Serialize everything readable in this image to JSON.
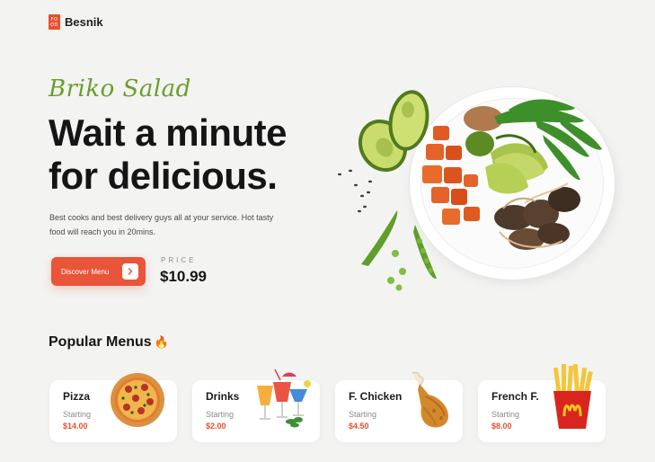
{
  "brand": {
    "logo_line1": "FO",
    "logo_line2": "OD",
    "name": "Besnik"
  },
  "hero": {
    "script_title": "Briko Salad",
    "headline_line1": "Wait a minute",
    "headline_line2": "for delicious.",
    "description": "Best cooks and best delivery guys all at your service. Hot tasty food will reach you in 20mins.",
    "cta_label": "Discover Menu",
    "price_label": "PRICE",
    "price": "$10.99"
  },
  "popular": {
    "title": "Popular Menus",
    "items": [
      {
        "name": "Pizza",
        "starting": "Starting",
        "price": "$14.00",
        "icon": "pizza-icon"
      },
      {
        "name": "Drinks",
        "starting": "Starting",
        "price": "$2.00",
        "icon": "drinks-icon"
      },
      {
        "name": "F. Chicken",
        "starting": "Starting",
        "price": "$4.50",
        "icon": "chicken-drumstick-icon"
      },
      {
        "name": "French F.",
        "starting": "Starting",
        "price": "$8.00",
        "icon": "french-fries-icon"
      }
    ]
  },
  "colors": {
    "accent": "#e9553a",
    "script_green": "#6a9e2b",
    "background": "#f3f3f2"
  }
}
